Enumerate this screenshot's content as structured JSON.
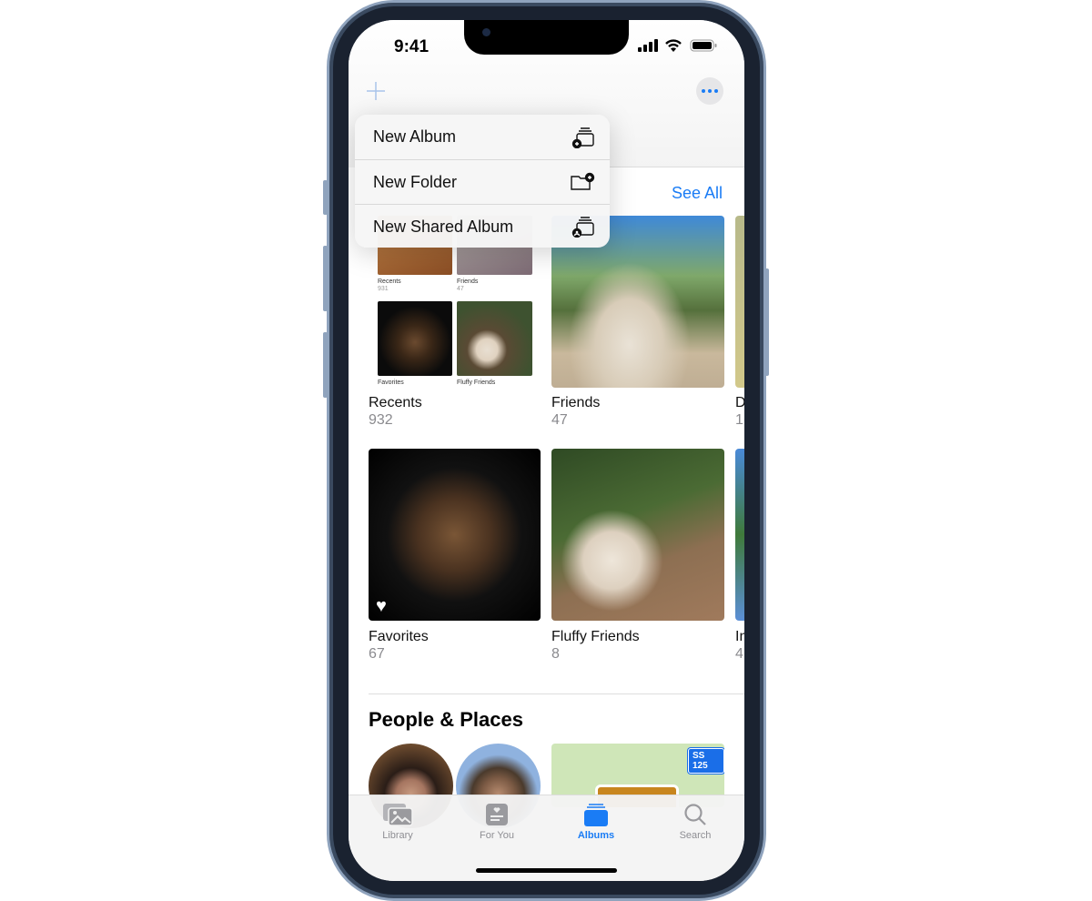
{
  "status": {
    "time": "9:41"
  },
  "toolbar": {
    "add_icon": "plus-icon",
    "more_icon": "ellipsis-icon"
  },
  "menu": {
    "items": [
      {
        "label": "New Album",
        "icon": "album-add-icon"
      },
      {
        "label": "New Folder",
        "icon": "folder-add-icon"
      },
      {
        "label": "New Shared Album",
        "icon": "shared-album-icon"
      }
    ]
  },
  "my_albums": {
    "see_all": "See All",
    "albums": [
      {
        "name": "Recents",
        "count": "932",
        "mini": [
          {
            "name": "Recents",
            "count": "931"
          },
          {
            "name": "Friends",
            "count": "47"
          },
          {
            "name": "Favorites"
          },
          {
            "name": "Fluffy Friends"
          }
        ]
      },
      {
        "name": "Friends",
        "count": "47"
      },
      {
        "name": "D",
        "count": "1("
      },
      {
        "name": "Favorites",
        "count": "67"
      },
      {
        "name": "Fluffy Friends",
        "count": "8"
      },
      {
        "name": "In",
        "count": "4"
      }
    ]
  },
  "people_places": {
    "title": "People & Places",
    "map_badge": "SS 125"
  },
  "tabs": [
    {
      "label": "Library",
      "icon": "photos-icon"
    },
    {
      "label": "For You",
      "icon": "for-you-icon"
    },
    {
      "label": "Albums",
      "icon": "albums-icon",
      "active": true
    },
    {
      "label": "Search",
      "icon": "search-icon"
    }
  ],
  "colors": {
    "accent": "#1a7cf5"
  }
}
